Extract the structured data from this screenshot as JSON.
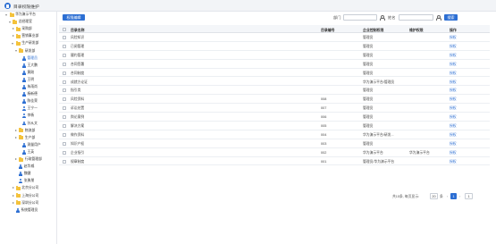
{
  "window": {
    "title": "目录权限维护"
  },
  "tree": [
    {
      "label": "华为演示平台",
      "kind": "folder",
      "state": "open"
    },
    {
      "label": "总经理室",
      "kind": "folder",
      "state": "open"
    },
    {
      "label": "采购部",
      "kind": "folder",
      "state": "closed"
    },
    {
      "label": "营销事业部",
      "kind": "folder",
      "state": "closed"
    },
    {
      "label": "生产研发部",
      "kind": "folder",
      "state": "open"
    },
    {
      "label": "研发部",
      "kind": "folder",
      "state": "open"
    },
    {
      "label": "管理员",
      "kind": "person",
      "state": "none",
      "selected": true
    },
    {
      "label": "王大鹏",
      "kind": "person",
      "state": "none"
    },
    {
      "label": "黄刚",
      "kind": "person",
      "state": "none"
    },
    {
      "label": "王明",
      "kind": "person",
      "state": "none"
    },
    {
      "label": "朱雨尚",
      "kind": "person",
      "state": "none"
    },
    {
      "label": "杨新德",
      "kind": "person",
      "state": "none"
    },
    {
      "label": "陈佳荣",
      "kind": "person",
      "state": "none"
    },
    {
      "label": "王宁一",
      "kind": "person",
      "state": "none"
    },
    {
      "label": "李杨",
      "kind": "person",
      "state": "none"
    },
    {
      "label": "孙从文",
      "kind": "person",
      "state": "none"
    },
    {
      "label": "物流部",
      "kind": "folder",
      "state": "closed"
    },
    {
      "label": "生产部",
      "kind": "folder",
      "state": "closed"
    },
    {
      "label": "测量用户",
      "kind": "person",
      "state": "none"
    },
    {
      "label": "王英",
      "kind": "person",
      "state": "none"
    },
    {
      "label": "行政管理部",
      "kind": "folder",
      "state": "closed"
    },
    {
      "label": "赵华威",
      "kind": "person",
      "state": "none"
    },
    {
      "label": "魏健",
      "kind": "person",
      "state": "none"
    },
    {
      "label": "张勇朋",
      "kind": "person",
      "state": "none"
    },
    {
      "label": "北京分公司",
      "kind": "folder",
      "state": "closed"
    },
    {
      "label": "上海分公司",
      "kind": "folder",
      "state": "closed"
    },
    {
      "label": "深圳分公司",
      "kind": "folder",
      "state": "closed"
    },
    {
      "label": "系统管理员",
      "kind": "person",
      "state": "none"
    }
  ],
  "toolbar": {
    "permission_button": "权限编辑",
    "dept_label": "部门",
    "dept_value": "",
    "name_label": "姓名",
    "name_value": "",
    "search_button": "搜索"
  },
  "table": {
    "headers": [
      "目录名称",
      "目录编号",
      "企业控制权限",
      "维护权限",
      "操作"
    ],
    "rows": [
      {
        "name": "风险知识",
        "code": "",
        "control": "管理员",
        "maintain": "",
        "action": "授权"
      },
      {
        "name": "已阅管理",
        "code": "",
        "control": "管理员",
        "maintain": "",
        "action": "授权"
      },
      {
        "name": "履约管理",
        "code": "",
        "control": "管理员",
        "maintain": "",
        "action": "授权"
      },
      {
        "name": "合同签署",
        "code": "",
        "control": "管理员",
        "maintain": "",
        "action": "授权"
      },
      {
        "name": "合同制度",
        "code": "",
        "control": "管理员",
        "maintain": "",
        "action": "授权"
      },
      {
        "name": "成就方论证",
        "code": "",
        "control": "华为演示平台/管理员",
        "maintain": "",
        "action": "授权"
      },
      {
        "name": "指引类",
        "code": "",
        "control": "管理员",
        "maintain": "",
        "action": "授权"
      },
      {
        "name": "风险资料",
        "code": "008",
        "control": "管理员",
        "maintain": "",
        "action": "授权"
      },
      {
        "name": "诉讼处置",
        "code": "007",
        "control": "管理员",
        "maintain": "",
        "action": "授权"
      },
      {
        "name": "舆论案例",
        "code": "006",
        "control": "管理员",
        "maintain": "",
        "action": "授权"
      },
      {
        "name": "解决方案",
        "code": "005",
        "control": "管理员",
        "maintain": "",
        "action": "授权"
      },
      {
        "name": "做作资料",
        "code": "004",
        "control": "华为演示平台/研发...",
        "maintain": "",
        "action": "授权"
      },
      {
        "name": "知识产权",
        "code": "003",
        "control": "管理员",
        "maintain": "",
        "action": "授权"
      },
      {
        "name": "企业指引",
        "code": "002",
        "control": "华为演示平台",
        "maintain": "华为演示平台",
        "action": "授权"
      },
      {
        "name": "规章制度",
        "code": "001",
        "control": "管理员/华为演示平台",
        "maintain": "",
        "action": "授权"
      }
    ]
  },
  "pager": {
    "summary": "共15条, 每页显示:",
    "page_size": "20",
    "unit": "条",
    "current_page": "1",
    "jump_value": "1"
  },
  "colors": {
    "accent": "#2d6fd3",
    "folder": "#f4c23b"
  }
}
